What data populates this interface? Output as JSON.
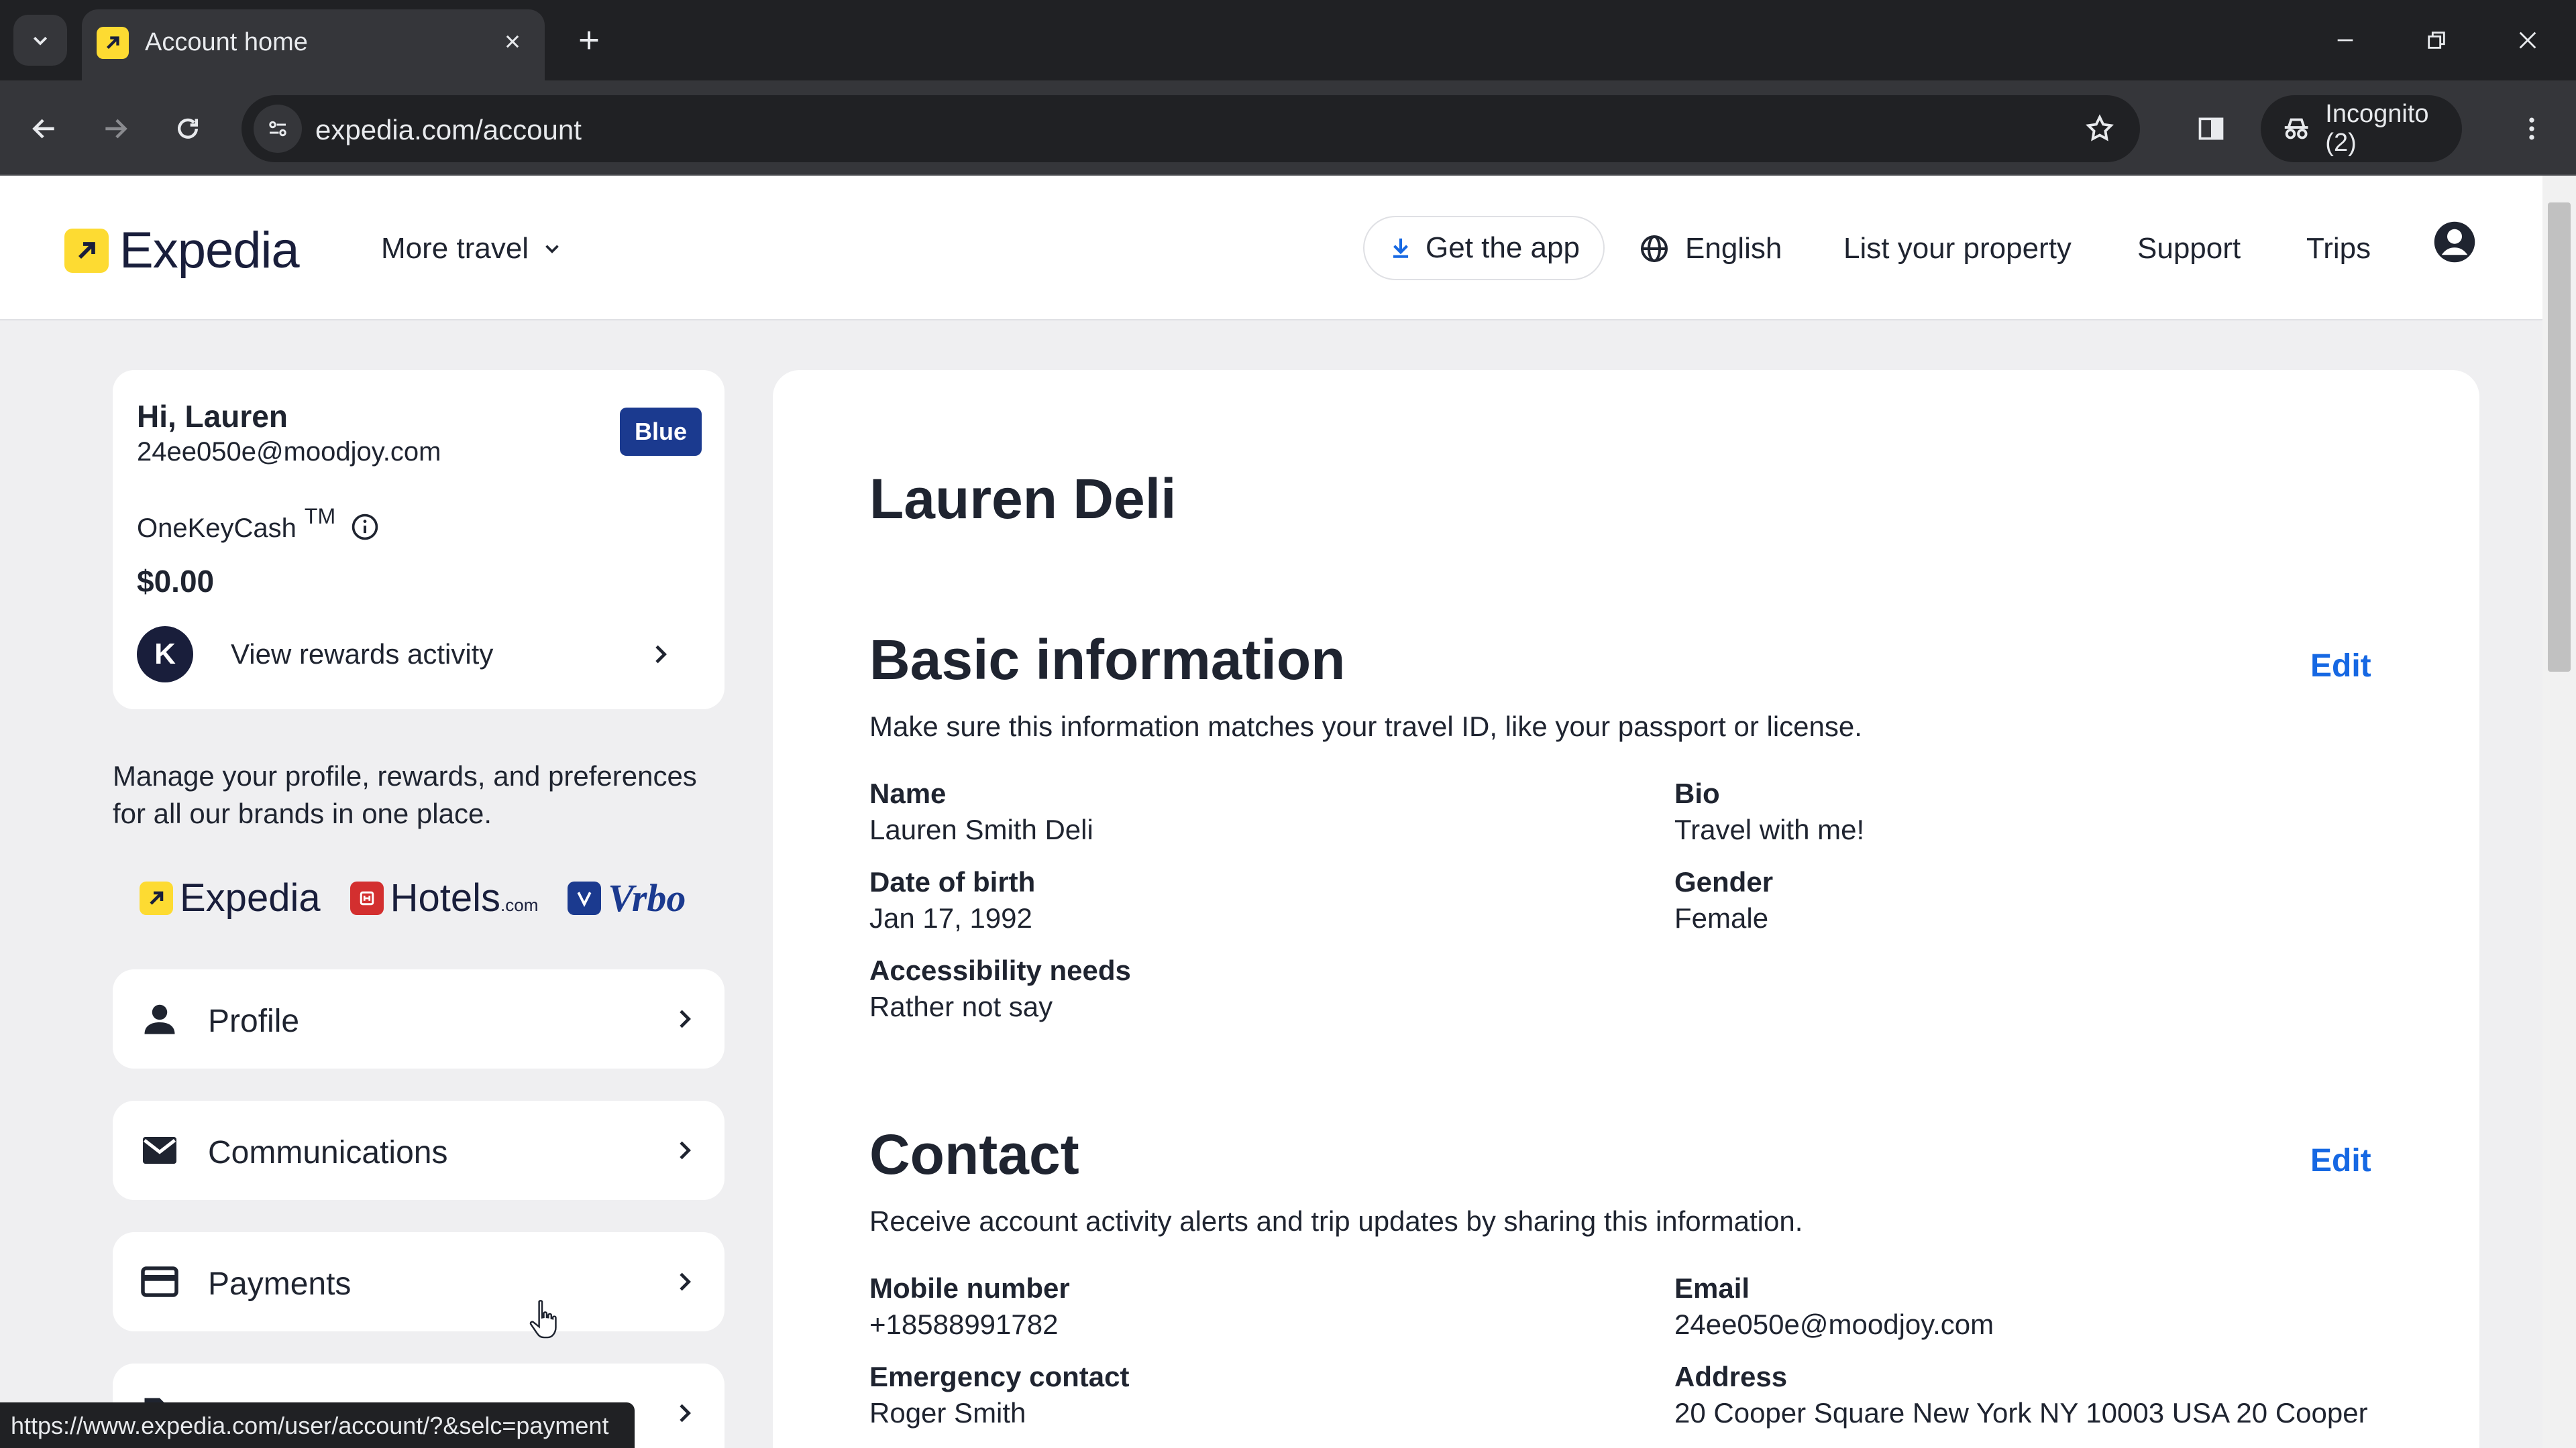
{
  "browser": {
    "tab_title": "Account home",
    "url": "expedia.com/account",
    "incognito_label": "Incognito (2)",
    "status_url": "https://www.expedia.com/user/account/?&selc=payment"
  },
  "header": {
    "brand": "Expedia",
    "more_travel": "More travel",
    "get_app": "Get the app",
    "language": "English",
    "list_property": "List your property",
    "support": "Support",
    "trips": "Trips"
  },
  "profile_card": {
    "greeting": "Hi, Lauren",
    "email": "24ee050e@moodjoy.com",
    "tier": "Blue",
    "onekeycash_label": "OneKeyCash",
    "onekeycash_tm": "TM",
    "balance": "$0.00",
    "rewards_link": "View rewards activity",
    "k_badge": "K"
  },
  "manage_text": "Manage your profile, rewards, and preferences for all our brands in one place.",
  "brands": {
    "expedia": "Expedia",
    "hotels": "Hotels",
    "hotels_suffix": ".com",
    "vrbo": "Vrbo"
  },
  "nav": {
    "profile": "Profile",
    "communications": "Communications",
    "payments": "Payments"
  },
  "main": {
    "name": "Lauren Deli",
    "basic": {
      "title": "Basic information",
      "edit": "Edit",
      "desc": "Make sure this information matches your travel ID, like your passport or license.",
      "name_label": "Name",
      "name_value": "Lauren Smith Deli",
      "bio_label": "Bio",
      "bio_value": "Travel with me!",
      "dob_label": "Date of birth",
      "dob_value": "Jan 17, 1992",
      "gender_label": "Gender",
      "gender_value": "Female",
      "access_label": "Accessibility needs",
      "access_value": "Rather not say"
    },
    "contact": {
      "title": "Contact",
      "edit": "Edit",
      "desc": "Receive account activity alerts and trip updates by sharing this information.",
      "mobile_label": "Mobile number",
      "mobile_value": "+18588991782",
      "email_label": "Email",
      "email_value": "24ee050e@moodjoy.com",
      "emergency_label": "Emergency contact",
      "emergency_value": "Roger Smith",
      "address_label": "Address",
      "address_value": "20 Cooper Square New York NY 10003 USA 20 Cooper"
    }
  },
  "colors": {
    "brand_yellow": "#fddb32",
    "link_blue": "#1668e3",
    "tier_blue": "#1b3a8f",
    "hotels_red": "#d32f2f"
  }
}
